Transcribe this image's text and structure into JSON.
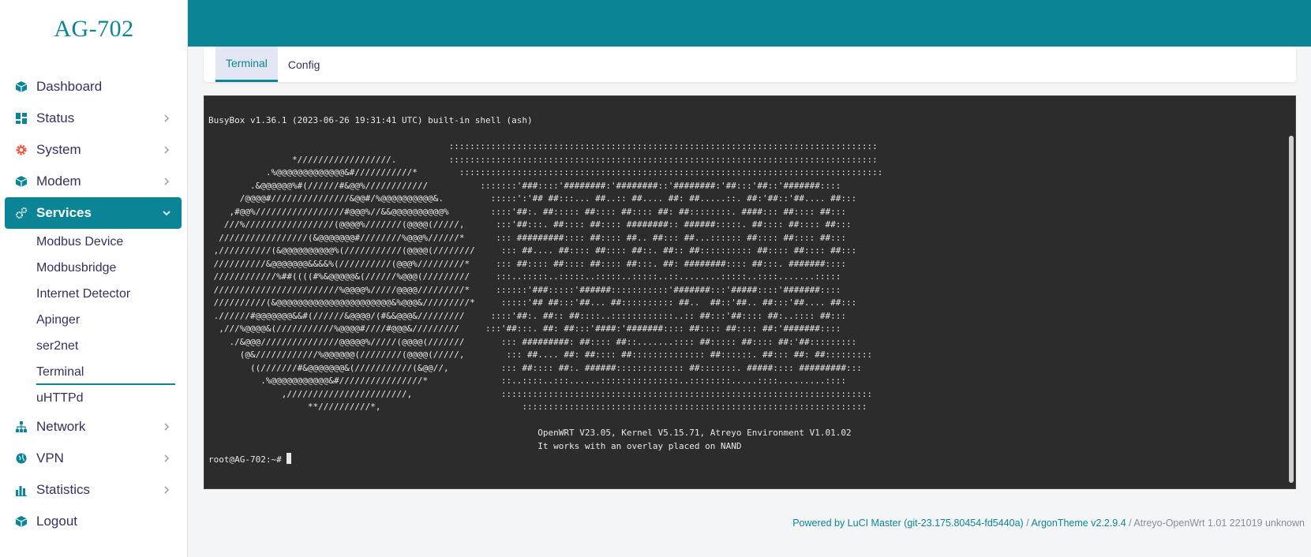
{
  "brand": "AG-702",
  "nav": {
    "dashboard": "Dashboard",
    "status": "Status",
    "system": "System",
    "modem": "Modem",
    "services": "Services",
    "services_sub": [
      "Modbus Device",
      "Modbusbridge",
      "Internet Detector",
      "Apinger",
      "ser2net",
      "Terminal",
      "uHTTPd"
    ],
    "network": "Network",
    "vpn": "VPN",
    "statistics": "Statistics",
    "logout": "Logout"
  },
  "tabs": {
    "terminal": "Terminal",
    "config": "Config"
  },
  "terminal": {
    "header": "BusyBox v1.36.1 (2023-06-26 19:31:41 UTC) built-in shell (ash)",
    "banner_lines": [
      "                                              ::::::::::::::::::::::::::::::::::::::::::::::::::::::::::::::::::::::::::::::::::",
      "                *//////////////////.          ::::::::::::::::::::::::::::::::::::::::::::::::::::::::::::::::::::::::::::::::::",
      "           .%@@@@@@@@@@@@@&#///////////*        :::::::::::::::::::::::::::::::::::::::::::::::::::::::::::::::::::::::::::::::::",
      "        .&@@@@@@%#(//////#&@@%////////////          :::::::'###::::'########:'########::'########:'##:::'##::'#######::::",
      "      /@@@@#///////////////&@@#/%@@@@@@@@@@&.         :::::':'## ##:::... ##..:: ##.... ##: ##.....::. ##:'##::'##.... ##:::",
      "    ,#@@%/////////////////#@@@%//&&@@@@@@@@@@%        ::::'##:. ##::::: ##:::: ##:::: ##: ##::::::::. ####::: ##:::: ##:::",
      "   ///%/////////////////(@@@@%///////(@@@@(/////,      :::'##:::. ##:::: ##:::: ########:: ######:::::. ##:::: ##:::: ##:::",
      "  /////////////////(&@@@@@@@#////////%@@@%//////*      ::: #########:::: ##:::: ##.. ##::: ##...:::::: ##:::: ##:::: ##:::",
      " ,//////////(&@@@@@@@@@@%(///////////(@@@@(////////     ::: ##.... ##:::: ##:::: ##::. ##:: ##:::::::::: ##:::: ##:::: ##:::",
      " //////////&@@@@@@@&&&&%(//////////(@@@%/////////*     ::: ##:::: ##:::: ##:::: ##:::. ##: ########:::: ##:::. #######::::",
      " ////////////%##((((#%&@@@@@&(//////%@@@(/////////     :::..:::::..:::::..:::::..:::::..::........:::::..::::.......:::::",
      " ////////////////////////%@@@@%/////@@@@/////////*     ::::::'###:::::'######:::::::::::'#######:::'#####::::'#######::::",
      " //////////(&@@@@@@@@@@@@@@@@@@@@@@&%@@@&/////////*     :::::'## ##:::'##... ##:::::::::: ##..  ##::'##.. ##:::'##.... ##:::",
      " .//////#@@@@@@@&&#(//////&@@@@/(#&&@@@&/////////     ::::'##:. ##:: ##::::..::::::::::::..:: ##:::'##:::: ##:..:::: ##:::",
      "  ,///%@@@@&(///////////%@@@@#////#@@@&/////////     :::'##:::. ##: ##:::'####:'#######:::: ##:::: ##:::: ##:'#######::::",
      "    ./&@@@///////////////@@@@@%/////(@@@@(///////       ::: #########: ##:::: ##::.......:::: ##::::: ##:::: ##:'##:::::::::",
      "      (@&////////////%@@@@@@(////////(@@@@(/////,        ::: ##.... ##: ##:::: ##:::::::::::::: ##::::::. ##::: ##: ##:::::::::",
      "        ((///////#&@@@@@@@&(///////////(&@@//,          ::: ##:::: ##:. ######::::::::::::: ##:::::::. #####:::: #########:::",
      "          .%@@@@@@@@@@@&#////////////////*              ::..::::..:::......:::::::::::::::..::::::::.....::::.........::::",
      "              ,///////////////////////,                 :::::::::::::::::::::::::::::::::::::::::::::::::::::::::::::::::::::::",
      "                   **//////////*,                           ::::::::::::::::::::::::::::::::::::::::::::::::::::::::::::::::::"
    ],
    "info_line1": "OpenWRT V23.05, Kernel V5.15.71, Atreyo Environment V1.01.02",
    "info_line2": "It works with an overlay placed on NAND",
    "prompt": "root@AG-702:~# "
  },
  "footer": {
    "powered_by": "Powered by LuCI Master (git-23.175.80454-fd5440a)",
    "sep1": " / ",
    "theme": "ArgonTheme v2.2.9.4",
    "sep2": " / ",
    "firmware": "Atreyo-OpenWrt 1.01 221019 unknown"
  },
  "colors": {
    "accent": "#0b8595",
    "terminal_bg": "#2c2c2c",
    "system_icon": "#f2553c"
  }
}
